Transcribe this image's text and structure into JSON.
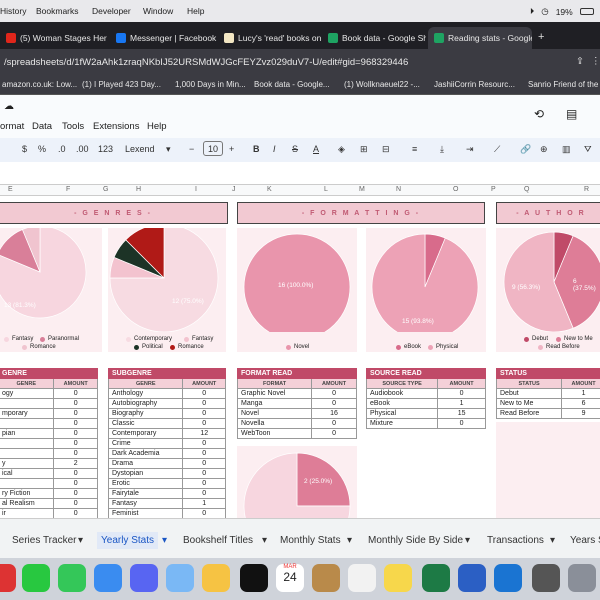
{
  "macbar": {
    "menus": [
      "History",
      "Bookmarks",
      "Developer",
      "Window",
      "Help"
    ],
    "battery": "19%"
  },
  "tabs": [
    {
      "label": "(5) Woman Stages Her C",
      "color": "#e0261b"
    },
    {
      "label": "Messenger | Facebook",
      "color": "#1877f2"
    },
    {
      "label": "Lucy's 'read' books on G",
      "color": "#f2e6c3"
    },
    {
      "label": "Book data - Google She",
      "color": "#1ea362"
    },
    {
      "label": "Reading stats - Google S",
      "color": "#1ea362"
    }
  ],
  "address": "/spreadsheets/d/1fW2aAhk1zraqNKbIJ52URSMdWJGcFEYZvz029duV7-U/edit#gid=968329446",
  "bookmarks": [
    "amazon.co.uk: Low...",
    "(1) I Played 423 Day...",
    "1,000 Days in Min...",
    "Book data - Google...",
    "(1) Wollknaeuel22 -...",
    "JashiiCorrin Resourc...",
    "Sanrio Friend of the"
  ],
  "menus": [
    "ormat",
    "Data",
    "Tools",
    "Extensions",
    "Help"
  ],
  "toolbar": {
    "dollar": "$",
    "percent": "%",
    "dec_less": ".0",
    "dec_more": ".00",
    "fmt": "123",
    "font": "Lexend",
    "size": "10",
    "minus": "−",
    "plus": "+",
    "bold": "B",
    "italic": "I",
    "strike": "S",
    "underline": "A"
  },
  "columns": [
    "E",
    "F",
    "G",
    "H",
    "I",
    "J",
    "K",
    "L",
    "M",
    "N",
    "O",
    "P",
    "Q",
    "R"
  ],
  "sections": {
    "genres": "- G E N R E S -",
    "formatting": "- F O R M A T T I N G -",
    "authors": "- A U T H O R"
  },
  "charts": {
    "genre_legend": [
      "Fantasy",
      "Paranormal",
      "Romance"
    ],
    "genre_label": "13 (81.3%)",
    "subgenre_legend": [
      "Contemporary",
      "Fantasy",
      "Political",
      "Romance"
    ],
    "subgenre_label": "12 (75.0%)",
    "format_legend": [
      "Novel"
    ],
    "format_label": "16 (100.0%)",
    "source_legend": [
      "eBook",
      "Physical"
    ],
    "source_label": "15 (93.8%)",
    "status_legend": [
      "Debut",
      "New to Me",
      "Read Before"
    ],
    "status_label_a": "9 (56.3%)",
    "status_label_b": "6 (37.5%)",
    "lower_label": "2 (25.0%)"
  },
  "chart_data": [
    {
      "type": "pie",
      "categories": [
        "Fantasy",
        "Paranormal",
        "Romance"
      ],
      "values": [
        13,
        2,
        1
      ],
      "colors": [
        "#f7d6df",
        "#d97f99",
        "#f0c4cf"
      ]
    },
    {
      "type": "pie",
      "categories": [
        "Contemporary",
        "Fantasy",
        "Political",
        "Romance"
      ],
      "values": [
        12,
        1,
        1,
        2
      ],
      "colors": [
        "#f7dbe2",
        "#f3c3cf",
        "#1c3326",
        "#b01a17"
      ]
    },
    {
      "type": "pie",
      "categories": [
        "Novel"
      ],
      "values": [
        16
      ],
      "colors": [
        "#e995ac"
      ]
    },
    {
      "type": "pie",
      "categories": [
        "eBook",
        "Physical"
      ],
      "values": [
        1,
        15
      ],
      "colors": [
        "#d86b8b",
        "#eda2b6"
      ]
    },
    {
      "type": "pie",
      "categories": [
        "Debut",
        "New to Me",
        "Read Before"
      ],
      "values": [
        1,
        6,
        9
      ],
      "colors": [
        "#c04a68",
        "#de7d97",
        "#f0b5c4"
      ]
    },
    {
      "type": "pie",
      "values": [
        2,
        6
      ],
      "colors": [
        "#de7d97",
        "#f7d6df"
      ]
    }
  ],
  "genre_table": {
    "title": "GENRE",
    "headers": [
      "GENRE",
      "AMOUNT"
    ],
    "rows": [
      [
        "ogy",
        "0"
      ],
      [
        "",
        "0"
      ],
      [
        "mporary",
        "0"
      ],
      [
        "",
        "0"
      ],
      [
        "pian",
        "0"
      ],
      [
        "",
        "0"
      ],
      [
        "",
        "0"
      ],
      [
        "y",
        "2"
      ],
      [
        "ical",
        "0"
      ],
      [
        "",
        "0"
      ],
      [
        "ry Fiction",
        "0"
      ],
      [
        "al Realism",
        "0"
      ],
      [
        "ir",
        "0"
      ]
    ]
  },
  "subgenre_table": {
    "title": "SUBGENRE",
    "headers": [
      "GENRE",
      "AMOUNT"
    ],
    "rows": [
      [
        "Anthology",
        "0"
      ],
      [
        "Autobiography",
        "0"
      ],
      [
        "Biography",
        "0"
      ],
      [
        "Classic",
        "0"
      ],
      [
        "Contemporary",
        "12"
      ],
      [
        "Crime",
        "0"
      ],
      [
        "Dark Academia",
        "0"
      ],
      [
        "Drama",
        "0"
      ],
      [
        "Dystopian",
        "0"
      ],
      [
        "Erotic",
        "0"
      ],
      [
        "Fairytale",
        "0"
      ],
      [
        "Fantasy",
        "1"
      ],
      [
        "Feminist",
        "0"
      ]
    ]
  },
  "format_table": {
    "title": "FORMAT READ",
    "headers": [
      "FORMAT",
      "AMOUNT"
    ],
    "rows": [
      [
        "Graphic Novel",
        "0"
      ],
      [
        "Manga",
        "0"
      ],
      [
        "Novel",
        "16"
      ],
      [
        "Novella",
        "0"
      ],
      [
        "WebToon",
        "0"
      ]
    ]
  },
  "source_table": {
    "title": "SOURCE READ",
    "headers": [
      "SOURCE TYPE",
      "AMOUNT"
    ],
    "rows": [
      [
        "Audiobook",
        "0"
      ],
      [
        "eBook",
        "1"
      ],
      [
        "Physical",
        "15"
      ],
      [
        "Mixture",
        "0"
      ]
    ]
  },
  "status_table": {
    "title": "STATUS",
    "headers": [
      "STATUS",
      "AMOUNT"
    ],
    "rows": [
      [
        "Debut",
        "1"
      ],
      [
        "New to Me",
        "6"
      ],
      [
        "Read Before",
        "9"
      ]
    ]
  },
  "sheet_tabs": [
    "Series Tracker",
    "Yearly Stats",
    "Bookshelf Titles",
    "Monthly Stats",
    "Monthly Side By Side",
    "Transactions",
    "Years S"
  ],
  "dock": {
    "calendar_month": "MAR",
    "calendar_day": "24"
  }
}
